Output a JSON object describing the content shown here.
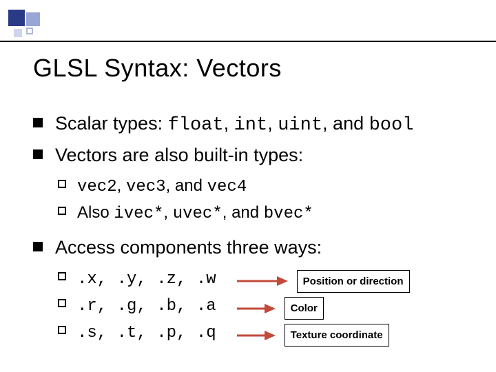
{
  "title": "GLSL Syntax:  Vectors",
  "bullets": {
    "b1_pre": "Scalar types:  ",
    "b1_t1": "float",
    "b1_c1": ", ",
    "b1_t2": "int",
    "b1_c2": ", ",
    "b1_t3": "uint",
    "b1_c3": ", and ",
    "b1_t4": "bool",
    "b2": "Vectors are also built-in types:",
    "b2a_t1": "vec2",
    "b2a_c1": ", ",
    "b2a_t2": "vec3",
    "b2a_c2": ", and ",
    "b2a_t3": "vec4",
    "b2b_pre": "Also ",
    "b2b_t1": "ivec*",
    "b2b_c1": ", ",
    "b2b_t2": "uvec*",
    "b2b_c2": ", and ",
    "b2b_t3": "bvec*",
    "b3": "Access components three ways:"
  },
  "access": [
    {
      "swizzle": ".x, .y, .z, .w",
      "label": "Position or direction"
    },
    {
      "swizzle": ".r, .g, .b, .a",
      "label": "Color"
    },
    {
      "swizzle": ".s, .t, .p, .q",
      "label": "Texture coordinate"
    }
  ],
  "colors": {
    "arrow_body": "#c24a3a",
    "arrow_head": "#c24a3a"
  }
}
